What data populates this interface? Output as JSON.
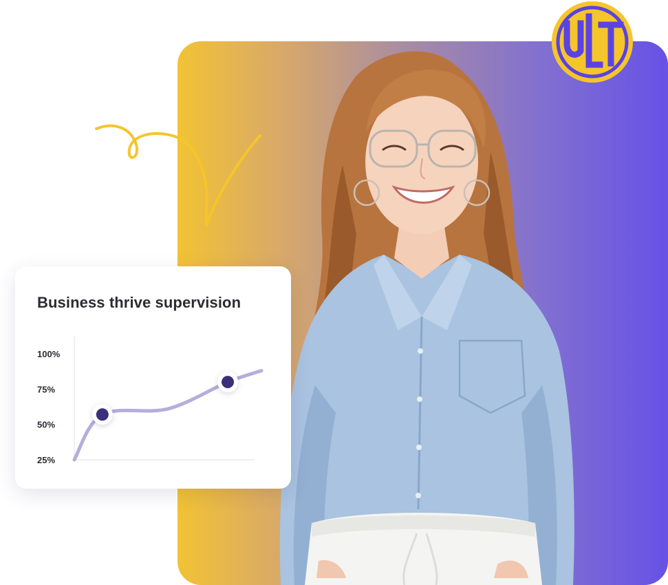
{
  "logo": {
    "name": "ULT"
  },
  "colors": {
    "gradient_start": "#f2c333",
    "gradient_end": "#6751e6",
    "accent_yellow": "#f5c52c",
    "logo_letter": "#5a43e0",
    "line": "#b3aedb",
    "dot": "#3a2f7a"
  },
  "chart_data": {
    "type": "line",
    "title": "Business thrive supervision",
    "xlabel": "",
    "ylabel": "",
    "ylim": [
      25,
      100
    ],
    "y_ticks": [
      "100%",
      "75%",
      "50%",
      "25%"
    ],
    "y_tick_values": [
      100,
      75,
      50,
      25
    ],
    "series": [
      {
        "x": [
          0,
          0.15,
          0.5,
          0.82,
          1.0
        ],
        "values": [
          25,
          57,
          61,
          80,
          88
        ]
      }
    ],
    "highlight_points": [
      {
        "x": 0.15,
        "value": 57
      },
      {
        "x": 0.82,
        "value": 80
      }
    ],
    "grid": false
  },
  "photo": {
    "subject": "smiling woman with glasses"
  }
}
